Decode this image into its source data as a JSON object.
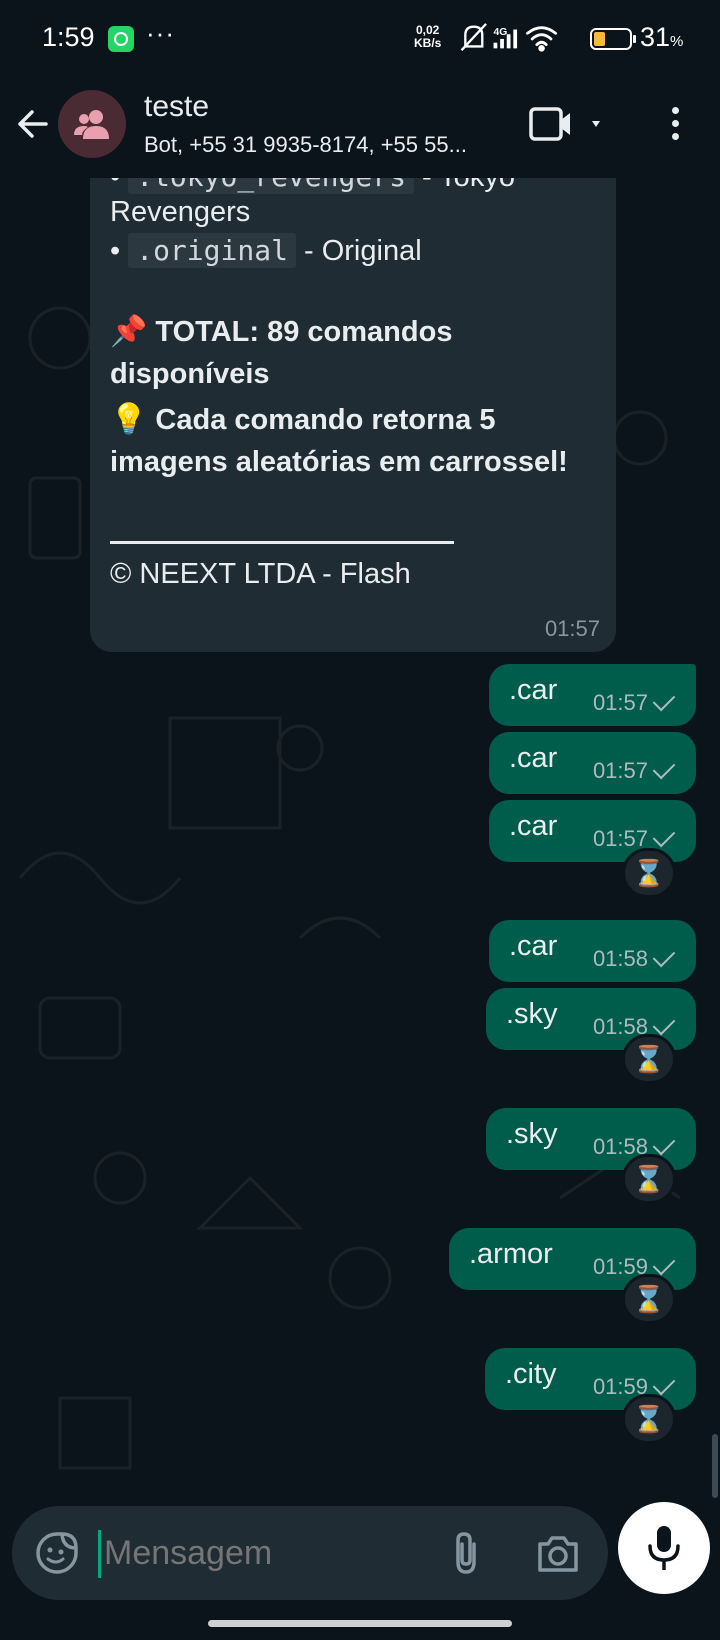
{
  "status_bar": {
    "time": "1:59",
    "more": "···",
    "speed_value": "0,02",
    "speed_unit": "KB/s",
    "network": "4G",
    "battery_percent": "31",
    "battery_unit": "%",
    "battery_level": 0.31
  },
  "header": {
    "title": "teste",
    "subtitle": "Bot, +55 31 9935-8174, +55 55..."
  },
  "incoming": {
    "lines": {
      "tokyo_code": ".tokyo_revengers",
      "tokyo_label": " - Tokyo",
      "tokyo_label2": "Revengers",
      "original_code": ".original",
      "original_label": " - Original",
      "total_emoji": "📌",
      "total_line1": "TOTAL: 89 comandos",
      "total_line2": "disponíveis",
      "tip_emoji": "💡",
      "tip_line1": "Cada comando retorna 5",
      "tip_line2": "imagens aleatórias em carrossel!",
      "footer": "© NEEXT LTDA - Flash",
      "bullet": "•"
    },
    "time": "01:57"
  },
  "outgoing": [
    {
      "text": ".car",
      "time": "01:57"
    },
    {
      "text": ".car",
      "time": "01:57"
    },
    {
      "text": ".car",
      "time": "01:57"
    },
    {
      "text": ".car",
      "time": "01:58"
    },
    {
      "text": ".sky",
      "time": "01:58"
    },
    {
      "text": ".sky",
      "time": "01:58"
    },
    {
      "text": ".armor",
      "time": "01:59"
    },
    {
      "text": ".city",
      "time": "01:59"
    }
  ],
  "reaction_emoji": "⌛",
  "input": {
    "placeholder": "Mensagem"
  },
  "colors": {
    "background": "#0b141a",
    "incoming_bubble": "#202c33",
    "outgoing_bubble": "#005c4b",
    "accent": "#00a884"
  },
  "icons": [
    "back-arrow-icon",
    "group-icon",
    "video-call-icon",
    "chevron-down-icon",
    "more-vert-icon",
    "sticker-icon",
    "attach-icon",
    "camera-icon",
    "mic-icon",
    "hourglass-icon"
  ]
}
